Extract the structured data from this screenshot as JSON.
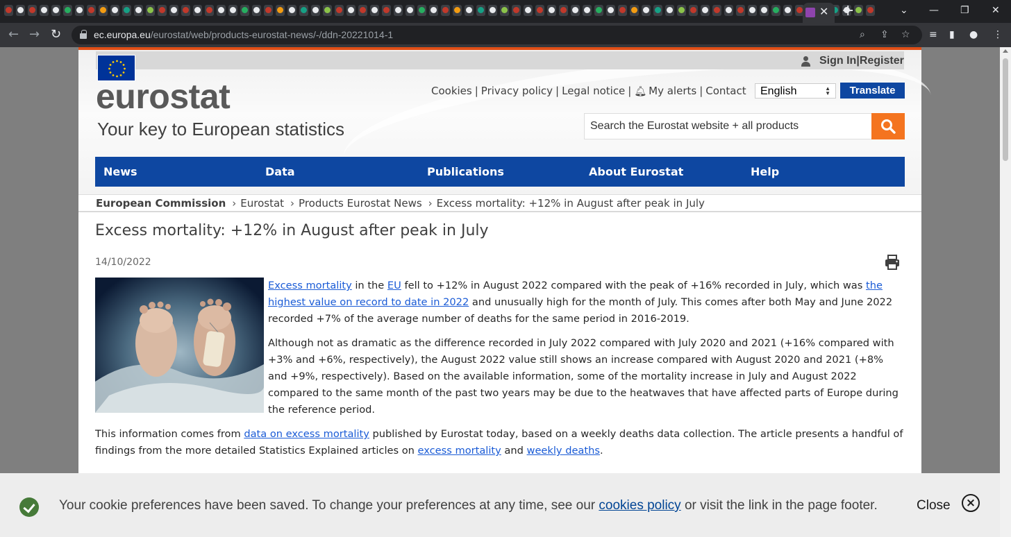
{
  "browser": {
    "active_tab_close": "✕",
    "new_tab": "+",
    "url_host": "ec.europa.eu",
    "url_path": "/eurostat/web/products-eurostat-news/-/ddn-20221014-1"
  },
  "header": {
    "sign_in": "Sign In",
    "register": "Register",
    "logo": "eurostat",
    "tagline": "Your key to European statistics",
    "links": {
      "cookies": "Cookies",
      "privacy": "Privacy policy",
      "legal": "Legal notice",
      "alerts": "My alerts",
      "contact": "Contact"
    },
    "language": "English",
    "translate": "Translate",
    "search_placeholder": "Search the Eurostat website + all products"
  },
  "nav": {
    "news": "News",
    "data": "Data",
    "publications": "Publications",
    "about": "About Eurostat",
    "help": "Help"
  },
  "breadcrumb": {
    "home": "European Commission",
    "items": [
      "Eurostat",
      "Products Eurostat News",
      "Excess mortality: +12% in August after peak in July"
    ]
  },
  "article": {
    "title": "Excess mortality: +12% in August after peak in July",
    "date": "14/10/2022",
    "p1": {
      "link1": "Excess mortality",
      "t1": " in the ",
      "link2": "EU",
      "t2": " fell to +12% in August 2022 compared with the peak of +16% recorded in July, which was ",
      "link3": "the highest value on record to date in 2022",
      "t3": " and unusually high for the month of July. This comes after both May and June 2022 recorded +7% of the average number of deaths for the same period in 2016-2019."
    },
    "p2": "Although not as dramatic as the difference recorded in July 2022 compared with July 2020 and 2021 (+16% compared with +3% and +6%, respectively), the August 2022 value still shows an increase compared with August 2020 and 2021 (+8% and +9%, respectively). Based on the available information, some of the mortality increase in July and August 2022 compared to the same month of the past two years may be due to the heatwaves that have affected parts of Europe during the reference period.",
    "p3": {
      "t1": "This information comes from ",
      "link1": "data on excess mortality",
      "t2": " published by Eurostat today, based on a weekly deaths data collection. The article presents a handful of findings from the more detailed Statistics Explained articles on ",
      "link2": "excess mortality",
      "t3": " and ",
      "link3": "weekly deaths",
      "t4": "."
    }
  },
  "cookie_banner": {
    "t1": "Your cookie preferences have been saved. To change your preferences at any time, see our ",
    "link": "cookies policy",
    "t2": " or visit the link in the page footer.",
    "close": "Close"
  },
  "colors": {
    "accent_orange": "#e04e16",
    "nav_blue": "#0e47a1",
    "search_orange": "#f4741f",
    "link_blue": "#1a5bd6",
    "cookie_check_green": "#467a39"
  }
}
